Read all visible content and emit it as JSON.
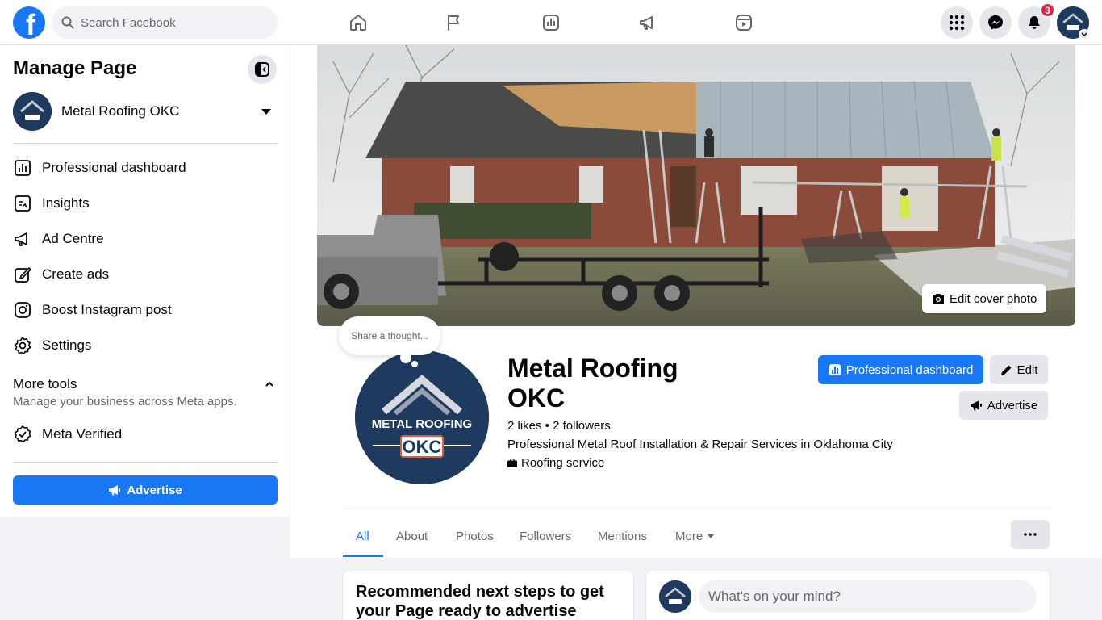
{
  "colors": {
    "brand": "#1877f2",
    "badge": "#e41e3f",
    "logo_bg": "#1f3a5f"
  },
  "topbar": {
    "search_placeholder": "Search Facebook",
    "nav_icons": [
      "home-icon",
      "flag-icon",
      "dashboard-icon",
      "megaphone-icon",
      "reels-icon"
    ],
    "notification_count": "3"
  },
  "logo": {
    "line1": "METAL ROOFING",
    "line2": "OKC"
  },
  "sidebar": {
    "title": "Manage Page",
    "page_name": "Metal Roofing OKC",
    "items": [
      {
        "label": "Professional dashboard",
        "icon": "dashboard-icon"
      },
      {
        "label": "Insights",
        "icon": "insights-icon"
      },
      {
        "label": "Ad Centre",
        "icon": "megaphone-icon"
      },
      {
        "label": "Create ads",
        "icon": "pencil-icon"
      },
      {
        "label": "Boost Instagram post",
        "icon": "instagram-icon"
      },
      {
        "label": "Settings",
        "icon": "gear-icon"
      }
    ],
    "more_tools": {
      "title": "More tools",
      "subtitle": "Manage your business across Meta apps."
    },
    "meta_verified": "Meta Verified",
    "advertise_label": "Advertise"
  },
  "profile": {
    "edit_cover_label": "Edit cover photo",
    "thought_placeholder": "Share a thought...",
    "name_line1": "Metal Roofing",
    "name_line2": "OKC",
    "stats": "2 likes • 2 followers",
    "description": "Professional Metal Roof Installation & Repair Services in Oklahoma City",
    "category": "Roofing service",
    "professional_dashboard_label": "Professional dashboard",
    "edit_label": "Edit",
    "advertise_label": "Advertise"
  },
  "tabs": [
    "All",
    "About",
    "Photos",
    "Followers",
    "Mentions",
    "More"
  ],
  "active_tab": "All",
  "recommended": {
    "title": "Recommended next steps to get your Page ready to advertise"
  },
  "composer": {
    "placeholder": "What's on your mind?"
  }
}
